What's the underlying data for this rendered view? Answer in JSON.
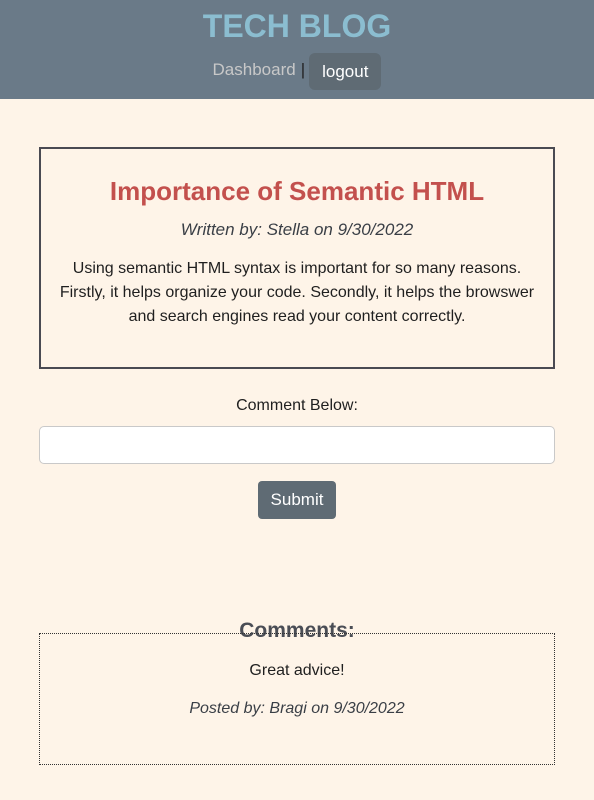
{
  "header": {
    "brand": "TECH BLOG",
    "nav": {
      "dashboard_label": "Dashboard",
      "separator": "|",
      "logout_label": "logout"
    }
  },
  "post": {
    "title": "Importance of Semantic HTML",
    "byline": "Written by: Stella on 9/30/2022",
    "body": "Using semantic HTML syntax is important for so many reasons. Firstly, it helps organize your code. Secondly, it helps the browswer and search engines read your content correctly."
  },
  "comment_form": {
    "label": "Comment Below:",
    "input_value": "",
    "submit_label": "Submit"
  },
  "comments": {
    "heading": "Comments:",
    "items": [
      {
        "text": "Great advice!",
        "byline": "Posted by: Bragi on 9/30/2022"
      }
    ]
  },
  "colors": {
    "page_background": "#fef4e8",
    "header_background": "#6a7a88",
    "brand": "#8bbdd0",
    "post_title": "#c3504d",
    "button": "#5f6b74"
  }
}
